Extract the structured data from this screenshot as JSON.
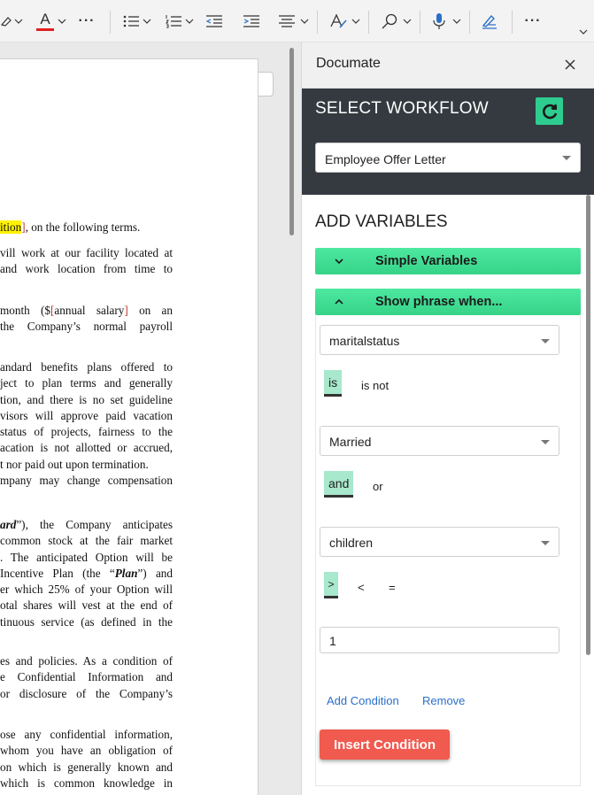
{
  "toolbar": {
    "more_label_1": "···",
    "more_label_2": "···",
    "items": [
      "eraser-icon",
      "font-color-icon",
      "more-icon",
      "bullets-icon",
      "numbering-icon",
      "decrease-indent-icon",
      "increase-indent-icon",
      "align-icon",
      "styles-icon",
      "find-icon",
      "dictate-icon",
      "editor-icon",
      "more-icon",
      "expand-icon"
    ],
    "font_color_letter": "A",
    "font_color": "#e02020"
  },
  "document": {
    "lines_block1": [
      {
        "pre": "",
        "hl": "ition",
        "post_red": "]",
        "rest": ", on the following terms."
      }
    ],
    "block2": [
      "vill work at our facility located at",
      "and work location from time to"
    ],
    "block3_line1": {
      "a": "month ($",
      "red1": "[",
      "b": "annual salary",
      "red2": "]",
      "c": " on an"
    },
    "block3_line2": "the Company’s normal payroll",
    "block4": [
      "andard benefits plans offered to",
      "ject to plan terms and generally",
      "tion, and there is no set guideline",
      "visors will approve paid vacation",
      "status of projects, fairness to the",
      "acation is not allotted or accrued,",
      "t nor paid out upon termination.",
      "mpany may change compensation"
    ],
    "block5_line1": {
      "em": "ard",
      "rest": "”), the Company anticipates"
    },
    "block5": [
      "common stock at the fair market",
      ". The anticipated Option will be"
    ],
    "block5_plan": {
      "a": "Incentive Plan (the “",
      "em": "Plan",
      "b": "”) and"
    },
    "block5b": [
      "er which 25% of your Option will",
      "otal shares will vest at the end of",
      "tinuous service (as defined in the"
    ],
    "block6": [
      "es and policies. As a condition of",
      "e Confidential Information and",
      "or disclosure of the Company’s"
    ],
    "block7": [
      "ose any confidential information,",
      "whom you have an obligation of",
      "on which is generally known and",
      "which is common knowledge in"
    ]
  },
  "pane": {
    "title": "Documate",
    "select_workflow_title": "SELECT WORKFLOW",
    "workflow_value": "Employee Offer Letter",
    "add_variables_title": "ADD VARIABLES",
    "simple_variables_label": "Simple Variables",
    "show_phrase_label": "Show phrase when...",
    "condition": {
      "field1": "maritalstatus",
      "op1_selected": "is",
      "op1_other": "is not",
      "value1": "Married",
      "join_selected": "and",
      "join_other": "or",
      "field2": "children",
      "op2_selected": ">",
      "op2_lt": "<",
      "op2_eq": "=",
      "value2": "1"
    },
    "add_condition_label": "Add Condition",
    "remove_label": "Remove",
    "insert_condition_label": "Insert Condition",
    "colors": {
      "header_dark": "#343a40",
      "accent_green": "#3ee08f",
      "chip_green": "#a8e8cc",
      "insert_red": "#f05a4f",
      "link_blue": "#2a6fc9"
    }
  }
}
